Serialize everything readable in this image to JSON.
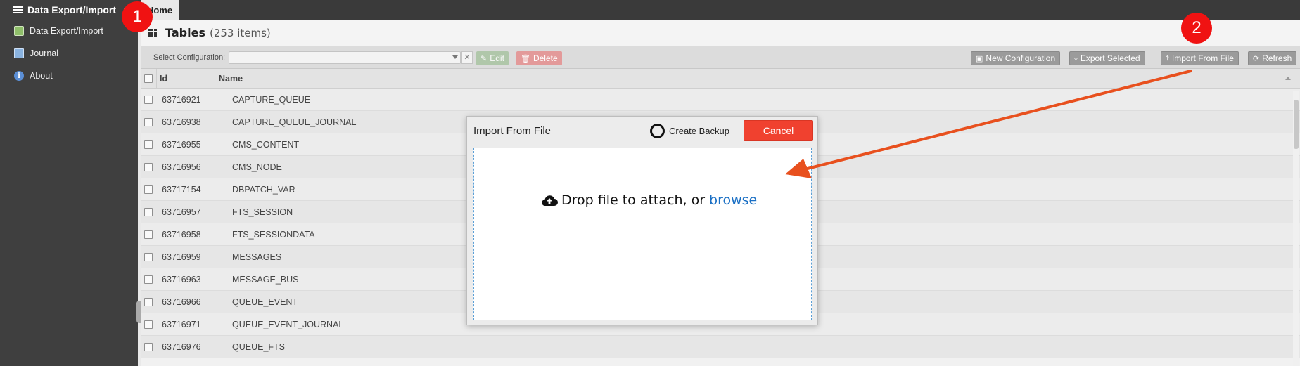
{
  "app": {
    "title": "Data Export/Import",
    "home_tab": "Home"
  },
  "sidebar": {
    "items": [
      {
        "label": "Data Export/Import",
        "icon": "export-icon"
      },
      {
        "label": "Journal",
        "icon": "journal-icon"
      },
      {
        "label": "About",
        "icon": "info-icon"
      }
    ]
  },
  "page": {
    "title": "Tables",
    "count": "(253 items)"
  },
  "toolbar": {
    "select_label": "Select Configuration:",
    "select_value": "",
    "clear_glyph": "✕",
    "edit_label": "Edit",
    "delete_label": "Delete",
    "new_config_label": "New Configuration",
    "export_label": "Export Selected",
    "import_label": "Import From File",
    "refresh_label": "Refresh"
  },
  "table": {
    "headers": {
      "id": "Id",
      "name": "Name"
    },
    "rows": [
      {
        "id": "63716921",
        "name": "CAPTURE_QUEUE"
      },
      {
        "id": "63716938",
        "name": "CAPTURE_QUEUE_JOURNAL"
      },
      {
        "id": "63716955",
        "name": "CMS_CONTENT"
      },
      {
        "id": "63716956",
        "name": "CMS_NODE"
      },
      {
        "id": "63717154",
        "name": "DBPATCH_VAR"
      },
      {
        "id": "63716957",
        "name": "FTS_SESSION"
      },
      {
        "id": "63716958",
        "name": "FTS_SESSIONDATA"
      },
      {
        "id": "63716959",
        "name": "MESSAGES"
      },
      {
        "id": "63716963",
        "name": "MESSAGE_BUS"
      },
      {
        "id": "63716966",
        "name": "QUEUE_EVENT"
      },
      {
        "id": "63716971",
        "name": "QUEUE_EVENT_JOURNAL"
      },
      {
        "id": "63716976",
        "name": "QUEUE_FTS"
      }
    ]
  },
  "dialog": {
    "title": "Import From File",
    "backup_label": "Create Backup",
    "cancel_label": "Cancel",
    "drop_text": "Drop file to attach, or",
    "browse_text": "browse"
  },
  "annotations": {
    "marker1": "1",
    "marker2": "2",
    "arrow_color": "#e8501e",
    "marker_color": "#f01212"
  }
}
